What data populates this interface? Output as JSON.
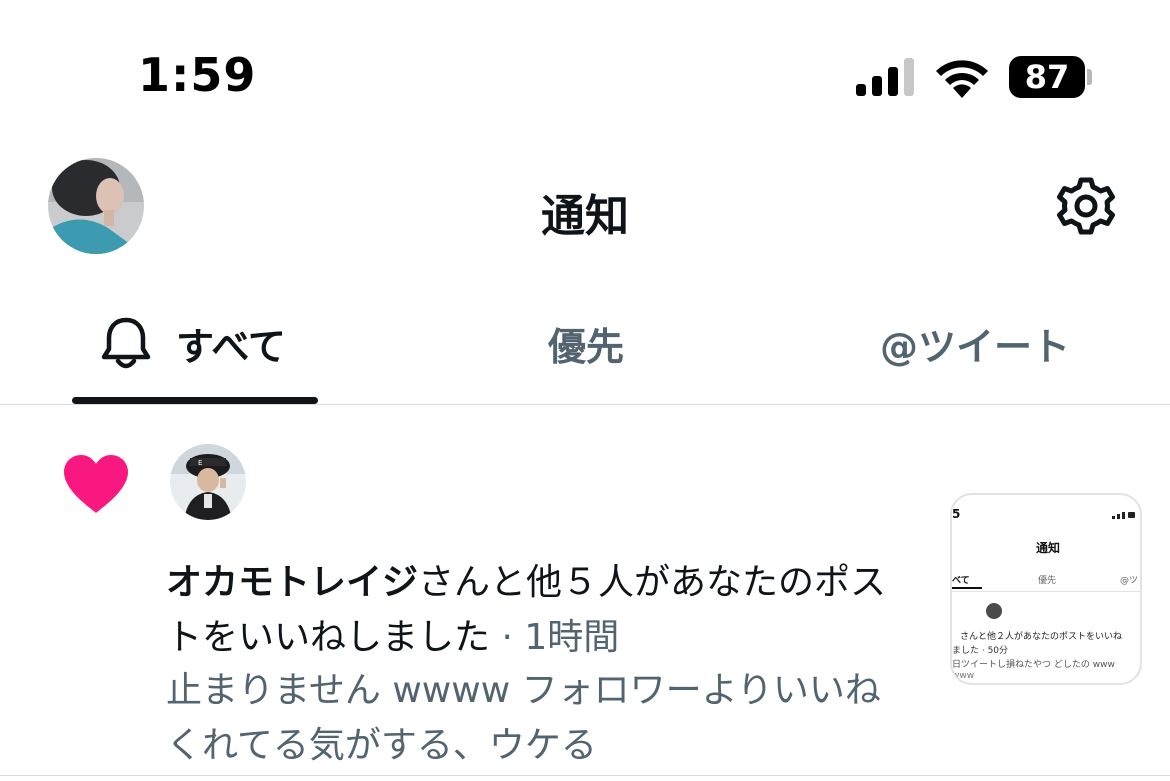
{
  "status_bar": {
    "time": "1:59",
    "battery_level": "87",
    "icons": [
      "cellular-signal-icon",
      "wifi-icon",
      "battery-icon"
    ]
  },
  "header": {
    "title": "通知",
    "icons": [
      "profile-avatar",
      "settings-gear-icon"
    ]
  },
  "tabs": [
    {
      "label": "すべて",
      "icon": "bell-icon",
      "active": true
    },
    {
      "label": "優先",
      "active": false
    },
    {
      "label": "@ツイート",
      "active": false
    }
  ],
  "notifications": [
    {
      "icon": "heart-icon",
      "icon_color": "#f91880",
      "actor": "オカモトレイジ",
      "message": "さんと他５人があなたのポストをいいねしました",
      "separator": " · ",
      "time": "1時間",
      "preview": "止まりません wwww フォロワーよりいいねくれてる気がする、ウケる",
      "thumbnail": {
        "time": "5",
        "title": "通知",
        "tabs": [
          "べて",
          "優先",
          "@ツ"
        ],
        "line1": "さんと他２人があなたのポストをいいね",
        "line2": "ました · 50分",
        "line3": "日ツイートし損ねたやつ どしたの www",
        "line4": "www"
      }
    }
  ],
  "colors": {
    "text_primary": "#0f1419",
    "text_secondary": "#536471",
    "like_pink": "#f91880",
    "divider": "#d8dde1"
  }
}
